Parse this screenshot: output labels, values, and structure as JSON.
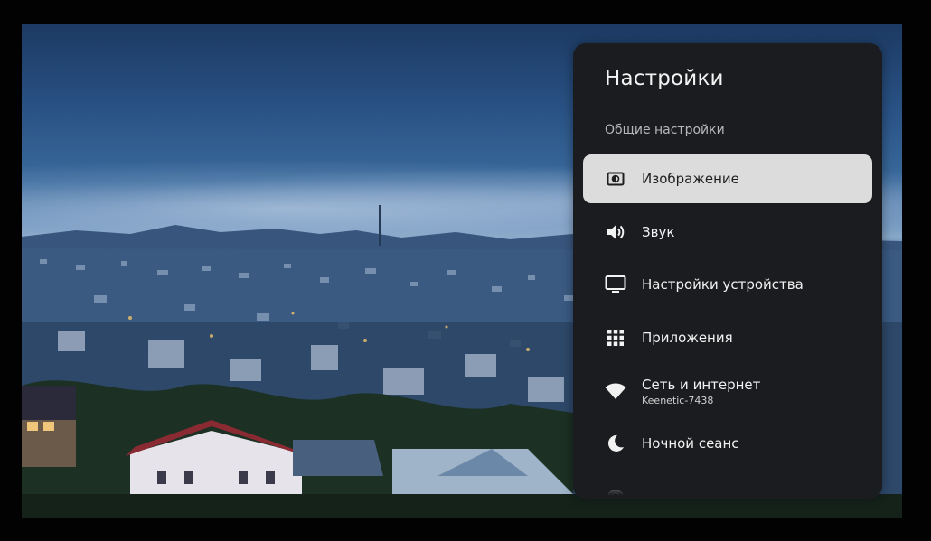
{
  "panel": {
    "title": "Настройки",
    "subtitle": "Общие настройки",
    "items": [
      {
        "label": "Изображение",
        "icon": "picture-mode-icon",
        "selected": true
      },
      {
        "label": "Звук",
        "icon": "speaker-icon",
        "selected": false
      },
      {
        "label": "Настройки устройства",
        "icon": "tv-monitor-icon",
        "selected": false
      },
      {
        "label": "Приложения",
        "icon": "apps-grid-icon",
        "selected": false
      },
      {
        "label": "Сеть и интернет",
        "sublabel": "Keenetic-7438",
        "icon": "wifi-icon",
        "selected": false
      },
      {
        "label": "Ночной сеанс",
        "icon": "moon-icon",
        "selected": false
      }
    ]
  },
  "colors": {
    "panel_background": "#1b1c1f",
    "selected_background": "#dcdcdc",
    "text": "#f2f2f2",
    "subtitle_text": "#b7b7b9"
  }
}
